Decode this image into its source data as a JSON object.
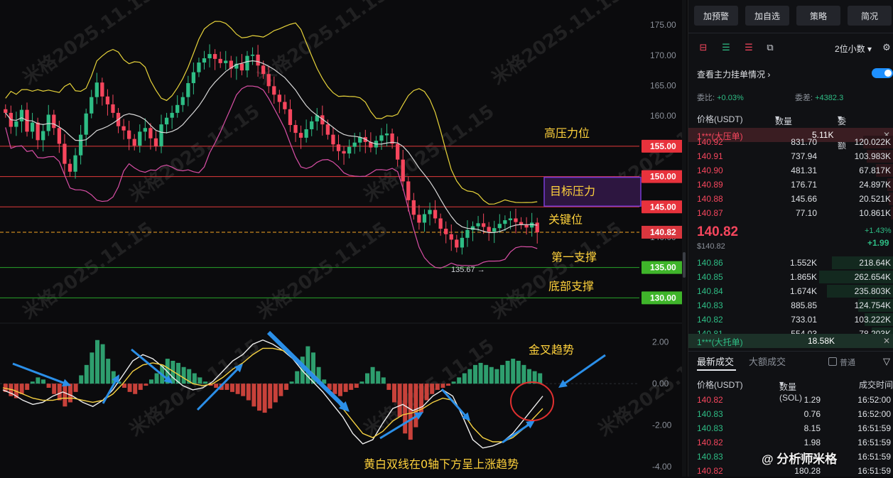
{
  "chart_data": {
    "type": "candlestick",
    "price_axis": {
      "ticks": [
        "175.00",
        "170.00",
        "165.00",
        "160.00",
        "155.00",
        "150.00",
        "145.00",
        "140.00",
        "135.00",
        "130.00"
      ],
      "ylim": [
        127,
        177
      ]
    },
    "macd_axis": {
      "ticks": [
        "2.00",
        "0.00",
        "-2.00",
        "-4.00"
      ],
      "ylim": [
        -4.1,
        2.4
      ]
    },
    "levels": [
      {
        "value": 155,
        "label": "155.00",
        "color": "#e23b3b",
        "text": "高压力位"
      },
      {
        "value": 150,
        "label": "150.00",
        "color": "#e23b3b",
        "text": ""
      },
      {
        "value": 145,
        "label": "145.00",
        "color": "#e23b3b",
        "text": "关键位"
      },
      {
        "value": 135,
        "label": "135.00",
        "color": "#29a329",
        "text": "第一支撑"
      },
      {
        "value": 130,
        "label": "130.00",
        "color": "#29a329",
        "text": "底部支撑"
      }
    ],
    "current_price": {
      "value": 140.82,
      "label": "140.82"
    },
    "low_marker": {
      "value": 135.67,
      "label": "135.67 →"
    },
    "target_box_text": "目标压力",
    "macd_annotations": {
      "golden_cross": "金叉趋势",
      "bottom_note": "黄白双线在0轴下方呈上涨趋势"
    },
    "watermark": "米格2025.11.15",
    "close_series": [
      160.5,
      158.2,
      159.1,
      161,
      157.4,
      158.9,
      156,
      157.5,
      160.2,
      158,
      155.4,
      152.1,
      150.8,
      153.5,
      156.9,
      160.4,
      163.1,
      165.5,
      163.2,
      161.9,
      160.5,
      158.3,
      157.6,
      156.2,
      155.1,
      157.4,
      158,
      156.3,
      155,
      158.6,
      159.7,
      160.5,
      161.8,
      163.1,
      165.4,
      167.2,
      168.8,
      169.5,
      170.2,
      169.4,
      168.7,
      169.1,
      167.8,
      168.6,
      167.5,
      169.9,
      170.1,
      168.3,
      166.9,
      164.9,
      163.5,
      162.3,
      161.1,
      158.5,
      157.2,
      156.4,
      157.8,
      159.1,
      160.1,
      158.6,
      156.9,
      155.3,
      154.2,
      153.8,
      154.9,
      155.6,
      156.5,
      155.7,
      154.8,
      155.9,
      156.8,
      157.1,
      155.4,
      152.8,
      149.2,
      146.1,
      143.7,
      142.4,
      143.8,
      144.5,
      143.1,
      141.4,
      140.5,
      139.6,
      138.3,
      139.9,
      141.2,
      141.8,
      142.3,
      141.7,
      140.9,
      141.5,
      142.2,
      142.8,
      143.1,
      142.5,
      142.1,
      141.6,
      142.4,
      140.8
    ],
    "macd_hist": [
      -0.4,
      -0.6,
      -0.7,
      -0.5,
      -0.3,
      0.1,
      0.3,
      0.2,
      -0.2,
      -0.5,
      -0.8,
      -1.1,
      -0.9,
      -0.4,
      0.4,
      0.9,
      1.5,
      2.1,
      1.9,
      1.2,
      0.6,
      0.1,
      -0.2,
      -0.4,
      -0.5,
      -0.3,
      -0.1,
      0.2,
      0.5,
      0.9,
      1.2,
      1.1,
      1.0,
      0.8,
      0.7,
      0.5,
      0.3,
      0.1,
      -0.1,
      -0.2,
      -0.3,
      -0.3,
      -0.4,
      -0.5,
      -0.6,
      -0.8,
      -1.1,
      -1.3,
      -1.4,
      -1.2,
      -0.9,
      -0.6,
      -0.3,
      0.1,
      0.6,
      1.3,
      1.8,
      1.5,
      0.8,
      0.2,
      -0.3,
      -0.5,
      -0.6,
      -0.4,
      -0.3,
      -0.2,
      0.1,
      0.5,
      0.8,
      0.6,
      0.3,
      -0.3,
      -0.9,
      -1.6,
      -2.4,
      -2.7,
      -2.1,
      -1.4,
      -0.8,
      -0.5,
      -0.3,
      -0.2,
      -0.1,
      0.1,
      0.3,
      0.5,
      0.7,
      0.9,
      1.0,
      0.9,
      0.8,
      0.7,
      0.9,
      1.1,
      1.2,
      1.1,
      0.9,
      0.7,
      0.6,
      0.5
    ],
    "dif": [
      -0.3,
      -0.5,
      -0.8,
      -1.0,
      -0.9,
      -0.6,
      -0.4,
      -0.6,
      -0.9,
      -1.1,
      -0.8,
      -0.3,
      0.4,
      1.1,
      1.4,
      1.2,
      0.8,
      0.3,
      -0.1,
      -0.3,
      -0.2,
      0.1,
      0.6,
      1.1,
      1.4,
      1.9,
      2.1,
      1.9,
      1.6,
      1.2,
      0.6,
      0.1,
      -0.4,
      -1.0,
      -1.6,
      -2.4,
      -2.9,
      -2.7,
      -1.9,
      -1.2,
      -1.0,
      -1.3,
      -1.1,
      -0.6,
      -0.3,
      -0.6,
      -1.6,
      -2.7,
      -3.1,
      -3.0,
      -2.8,
      -2.4,
      -1.8,
      -1.2,
      -0.6
    ],
    "dea": [
      -0.2,
      -0.3,
      -0.5,
      -0.7,
      -0.8,
      -0.8,
      -0.7,
      -0.7,
      -0.8,
      -0.9,
      -0.8,
      -0.5,
      0.0,
      0.6,
      0.9,
      1.0,
      0.9,
      0.6,
      0.3,
      0.0,
      -0.1,
      0.0,
      0.3,
      0.7,
      1.0,
      1.4,
      1.7,
      1.7,
      1.6,
      1.3,
      0.9,
      0.5,
      0.0,
      -0.6,
      -1.2,
      -1.8,
      -2.4,
      -2.6,
      -2.3,
      -1.8,
      -1.5,
      -1.4,
      -1.2,
      -0.9,
      -0.7,
      -0.8,
      -1.4,
      -2.1,
      -2.6,
      -2.8,
      -2.8,
      -2.6,
      -2.2,
      -1.7,
      -1.2
    ]
  },
  "toolbar": {
    "btn1": "加预警",
    "btn2": "加自选",
    "btn3": "策略",
    "btn4": "简况"
  },
  "orderbook": {
    "precision_label": "2位小数",
    "main_orders_label": "查看主力挂单情况",
    "ratio_label": "委比:",
    "ratio_value": "+0.03%",
    "diff_label": "委差:",
    "diff_value": "+4382.3",
    "col_price": "价格(USDT)",
    "col_qty": "数量 (SOL)",
    "col_total": "委托额",
    "big_sell_label": "1***(大压单)",
    "big_sell_value": "5.11K",
    "asks": [
      {
        "price": "140.92",
        "qty": "831.70",
        "total": "120.022K"
      },
      {
        "price": "140.91",
        "qty": "737.94",
        "total": "103.983K"
      },
      {
        "price": "140.90",
        "qty": "481.31",
        "total": "67.817K"
      },
      {
        "price": "140.89",
        "qty": "176.71",
        "total": "24.897K"
      },
      {
        "price": "140.88",
        "qty": "145.66",
        "total": "20.521K"
      },
      {
        "price": "140.87",
        "qty": "77.10",
        "total": "10.861K"
      }
    ],
    "last_price": "140.82",
    "last_price_sub": "$140.82",
    "change_pct": "+1.43%",
    "change_abs": "+1.99",
    "bids": [
      {
        "price": "140.86",
        "qty": "1.552K",
        "total": "218.64K"
      },
      {
        "price": "140.85",
        "qty": "1.865K",
        "total": "262.654K"
      },
      {
        "price": "140.84",
        "qty": "1.674K",
        "total": "235.803K"
      },
      {
        "price": "140.83",
        "qty": "885.85",
        "total": "124.754K"
      },
      {
        "price": "140.82",
        "qty": "733.01",
        "total": "103.222K"
      },
      {
        "price": "140.81",
        "qty": "554.03",
        "total": "78.203K"
      }
    ],
    "big_buy_label": "1***(大托单)",
    "big_buy_value": "18.58K"
  },
  "trades": {
    "tab_latest": "最新成交",
    "tab_large": "大额成交",
    "normal_label": "普通",
    "col_price": "价格(USDT)",
    "col_qty": "数量(SOL)",
    "col_time": "成交时间",
    "rows": [
      {
        "price": "140.82",
        "qty": "1.29",
        "time": "16:52:00",
        "side": "sell"
      },
      {
        "price": "140.83",
        "qty": "0.76",
        "time": "16:52:00",
        "side": "buy"
      },
      {
        "price": "140.83",
        "qty": "8.15",
        "time": "16:51:59",
        "side": "buy"
      },
      {
        "price": "140.82",
        "qty": "1.98",
        "time": "16:51:59",
        "side": "sell"
      },
      {
        "price": "140.83",
        "qty": "38.92",
        "time": "16:51:59",
        "side": "buy"
      },
      {
        "price": "140.82",
        "qty": "180.28",
        "time": "16:51:59",
        "side": "sell"
      }
    ]
  },
  "footer_watermark": "@ 分析师米格",
  "colors": {
    "up": "#2ebd85",
    "down": "#f6465d",
    "red_line": "#e23b3b",
    "green_line": "#29a329",
    "yellow": "#f5d142",
    "accent": "#1e90ff"
  }
}
